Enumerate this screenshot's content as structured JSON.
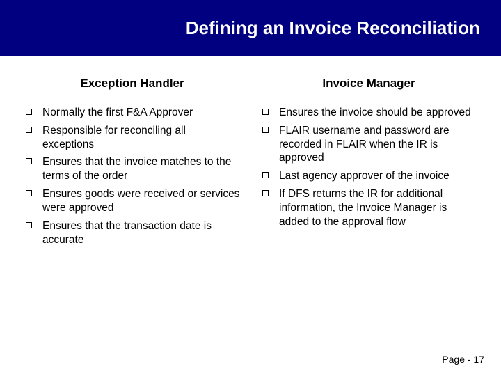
{
  "title": "Defining an Invoice Reconciliation",
  "left": {
    "heading": "Exception Handler",
    "items": [
      "Normally the first F&A Approver",
      "Responsible for reconciling all exceptions",
      "Ensures that the invoice matches to the terms of the order",
      "Ensures goods were received or services were approved",
      "Ensures that the transaction date is accurate"
    ]
  },
  "right": {
    "heading": "Invoice Manager",
    "items": [
      "Ensures the invoice should be approved",
      "FLAIR username and password are recorded in FLAIR when the IR is approved",
      "Last agency approver of the invoice",
      "If DFS returns the IR for additional information, the Invoice Manager is added to the approval flow"
    ]
  },
  "footer": "Page - 17"
}
